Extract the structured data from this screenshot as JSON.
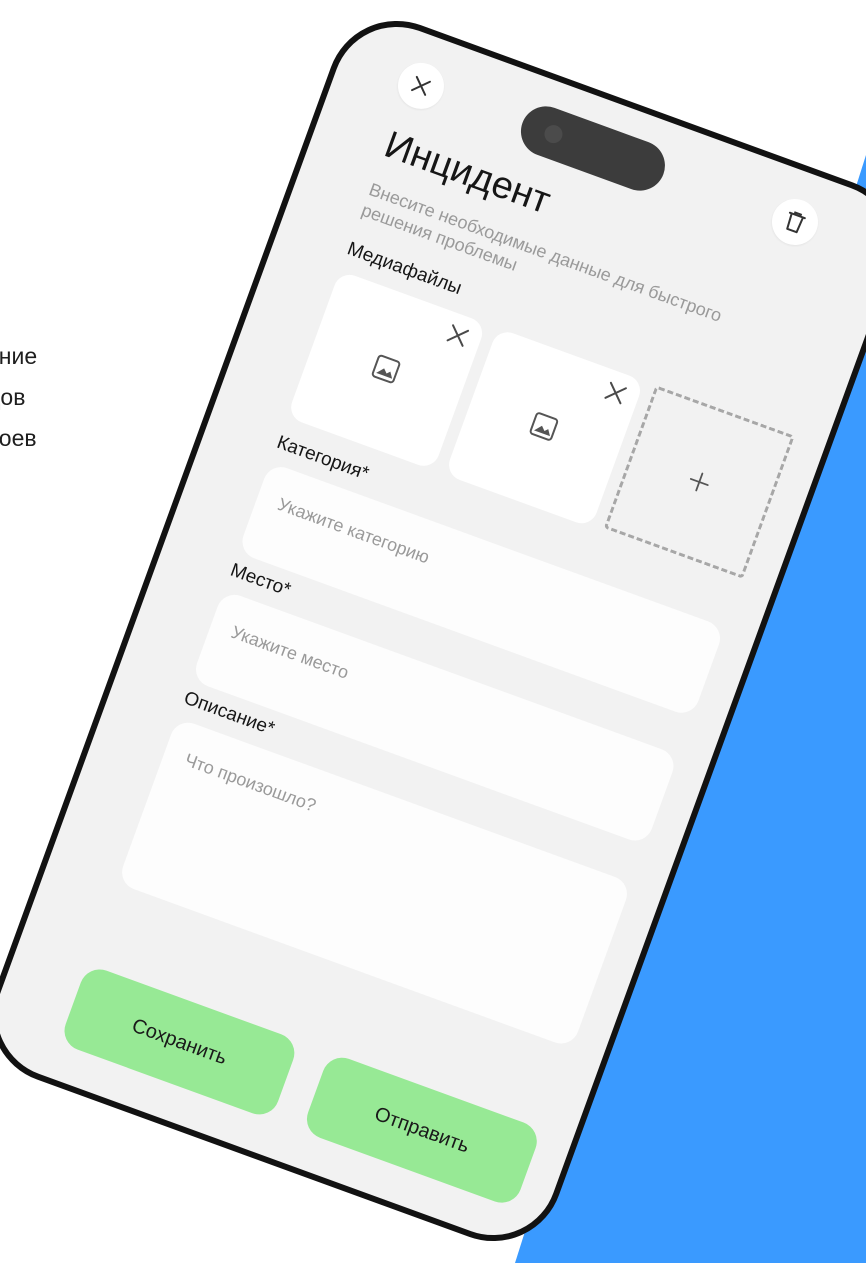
{
  "side_text": {
    "line1": "ение",
    "line2": "дов",
    "line3": "стоев"
  },
  "form": {
    "title": "Инцидент",
    "subtitle": "Внесите необходимые данные для быстрого решения проблемы",
    "media_label": "Медиафайлы",
    "category": {
      "label": "Категория*",
      "placeholder": "Укажите категорию"
    },
    "place": {
      "label": "Место*",
      "placeholder": "Укажите место"
    },
    "description": {
      "label": "Описание*",
      "placeholder": "Что произошло?"
    },
    "save_label": "Сохранить",
    "send_label": "Отправить"
  },
  "icons": {
    "close": "close-icon",
    "trash": "trash-icon",
    "image": "image-icon",
    "remove": "remove-icon",
    "add": "plus-icon"
  },
  "colors": {
    "accent_blue": "#3a9aff",
    "button_green": "#97e995",
    "screen_bg": "#f2f2f2",
    "frame": "#121212"
  }
}
